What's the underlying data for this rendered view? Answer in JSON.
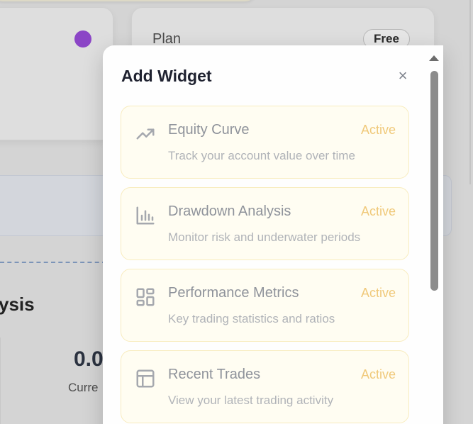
{
  "background": {
    "plan_label": "Plan",
    "plan_badge": "Free",
    "section_title": "ysis",
    "stat_value": "0.0",
    "stat_caption": "Curre"
  },
  "modal": {
    "title": "Add Widget",
    "close_glyph": "×",
    "widgets": [
      {
        "name": "Equity Curve",
        "status": "Active",
        "description": "Track your account value over time",
        "icon": "trending-up-icon"
      },
      {
        "name": "Drawdown Analysis",
        "status": "Active",
        "description": "Monitor risk and underwater periods",
        "icon": "bar-chart-icon"
      },
      {
        "name": "Performance Metrics",
        "status": "Active",
        "description": "Key trading statistics and ratios",
        "icon": "layout-grid-icon"
      },
      {
        "name": "Recent Trades",
        "status": "Active",
        "description": "View your latest trading activity",
        "icon": "table-layout-icon"
      }
    ]
  },
  "colors": {
    "accent_status": "#f0c97a",
    "widget_bg": "#fffdf2",
    "widget_border": "#f8ecbe",
    "plan_dot": "#8b45c6"
  }
}
